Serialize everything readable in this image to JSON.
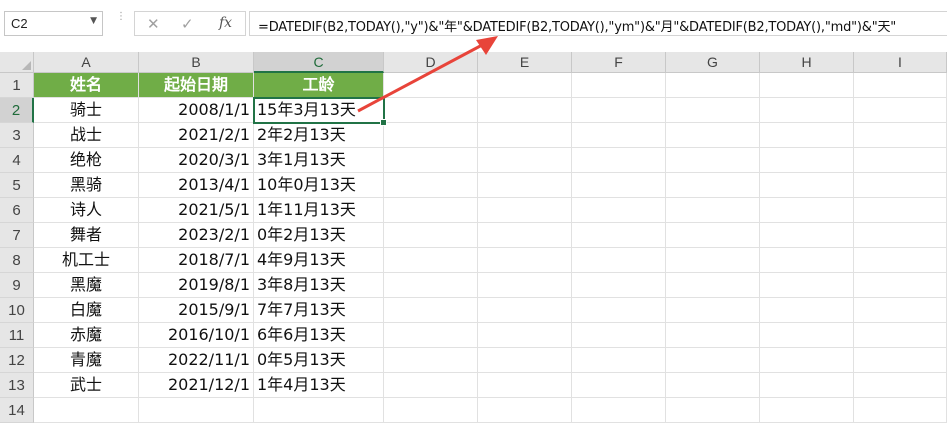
{
  "name_box": {
    "value": "C2"
  },
  "formula_bar": {
    "cancel_icon": "✕",
    "enter_icon": "✓",
    "fx_label": "fx",
    "formula": "=DATEDIF(B2,TODAY(),\"y\")&\"年\"&DATEDIF(B2,TODAY(),\"ym\")&\"月\"&DATEDIF(B2,TODAY(),\"md\")&\"天\""
  },
  "columns": [
    "A",
    "B",
    "C",
    "D",
    "E",
    "F",
    "G",
    "H",
    "I"
  ],
  "rows": [
    "1",
    "2",
    "3",
    "4",
    "5",
    "6",
    "7",
    "8",
    "9",
    "10",
    "11",
    "12",
    "13",
    "14"
  ],
  "selected_cell": "C2",
  "header_fill": "#70ad47",
  "selection_color": "#217346",
  "annotation_color": "#e8443a",
  "table": {
    "headers": [
      "姓名",
      "起始日期",
      "工龄"
    ],
    "rows": [
      [
        "骑士",
        "2008/1/1",
        "15年3月13天"
      ],
      [
        "战士",
        "2021/2/1",
        "2年2月13天"
      ],
      [
        "绝枪",
        "2020/3/1",
        "3年1月13天"
      ],
      [
        "黑骑",
        "2013/4/1",
        "10年0月13天"
      ],
      [
        "诗人",
        "2021/5/1",
        "1年11月13天"
      ],
      [
        "舞者",
        "2023/2/1",
        "0年2月13天"
      ],
      [
        "机工士",
        "2018/7/1",
        "4年9月13天"
      ],
      [
        "黑魔",
        "2019/8/1",
        "3年8月13天"
      ],
      [
        "白魔",
        "2015/9/1",
        "7年7月13天"
      ],
      [
        "赤魔",
        "2016/10/1",
        "6年6月13天"
      ],
      [
        "青魔",
        "2022/11/1",
        "0年5月13天"
      ],
      [
        "武士",
        "2021/12/1",
        "1年4月13天"
      ]
    ]
  }
}
